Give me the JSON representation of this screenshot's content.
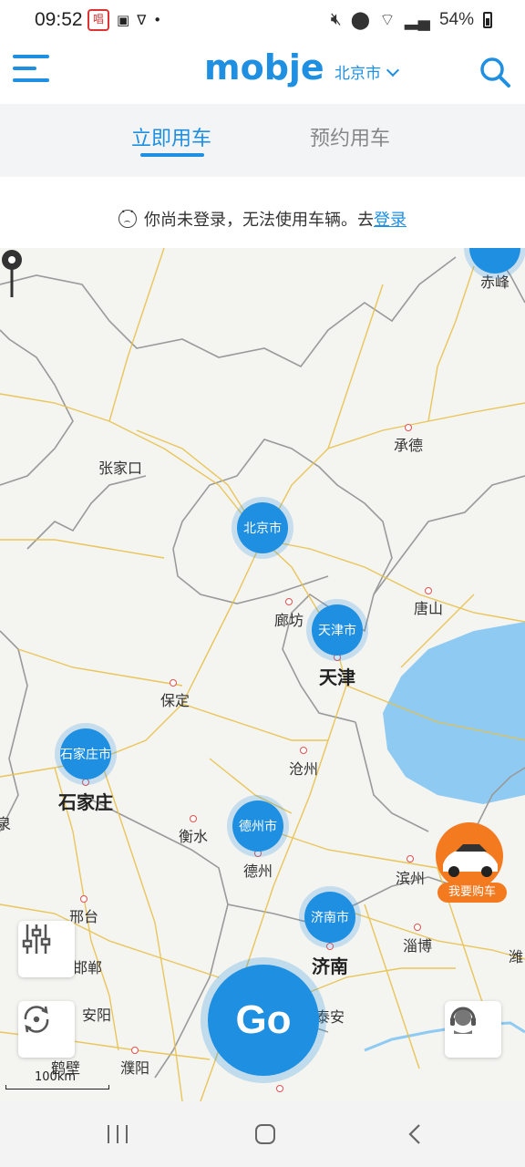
{
  "status_bar": {
    "time": "09:52",
    "battery": "54%",
    "notification_icons": [
      "唱",
      "image-icon",
      "vpn-icon",
      "dot-icon"
    ]
  },
  "header": {
    "logo": "mobje",
    "city": "北京市"
  },
  "tabs": [
    {
      "label": "立即用车",
      "active": true
    },
    {
      "label": "预约用车",
      "active": false
    }
  ],
  "notice": {
    "text": "你尚未登录，无法使用车辆。去",
    "link": "登录"
  },
  "map": {
    "cities": [
      {
        "name": "赤峰"
      },
      {
        "name": "承德"
      },
      {
        "name": "张家口"
      },
      {
        "name": "廊坊"
      },
      {
        "name": "唐山"
      },
      {
        "name": "天津"
      },
      {
        "name": "保定"
      },
      {
        "name": "沧州"
      },
      {
        "name": "石家庄"
      },
      {
        "name": "衡水"
      },
      {
        "name": "德州"
      },
      {
        "name": "滨州"
      },
      {
        "name": "邢台"
      },
      {
        "name": "淄博"
      },
      {
        "name": "济南"
      },
      {
        "name": "邯郸"
      },
      {
        "name": "潍"
      },
      {
        "name": "安阳"
      },
      {
        "name": "泰安"
      },
      {
        "name": "鹤壁"
      },
      {
        "name": "濮阳"
      },
      {
        "name": "泉"
      }
    ],
    "clusters": [
      {
        "name": "北京市"
      },
      {
        "name": "天津市"
      },
      {
        "name": "石家庄市"
      },
      {
        "name": "德州市"
      },
      {
        "name": "济南市"
      }
    ],
    "scale": "100km"
  },
  "buttons": {
    "go": "Go",
    "buy_car": "我要购车"
  },
  "colors": {
    "accent": "#1e8fe1",
    "buy": "#f47a20",
    "sea": "#8ecaf1"
  }
}
